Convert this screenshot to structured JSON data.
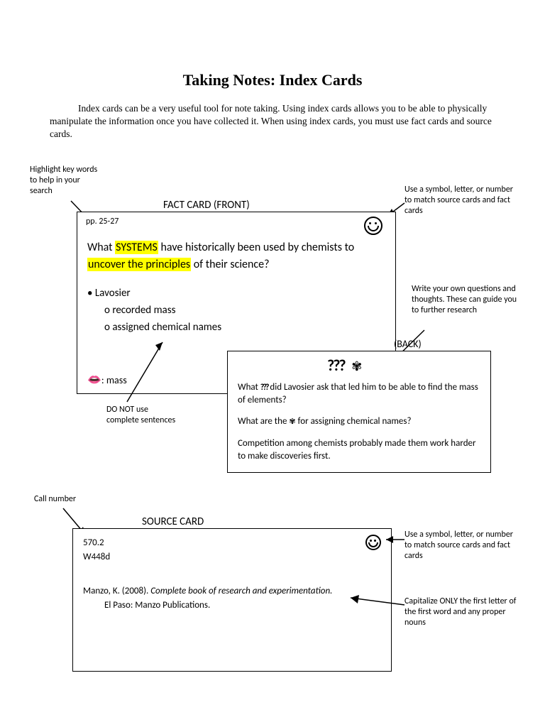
{
  "title": "Taking Notes: Index Cards",
  "intro": "Index cards can be a very useful tool for note taking.  Using index cards allows you to be able to physically manipulate the information once you have collected it.  When using index cards, you must use fact cards and source cards.",
  "callouts": {
    "highlight": "Highlight key words to help in your search",
    "match1": "Use a symbol, letter, or number to match source cards and fact cards",
    "thoughts": "Write your own questions and thoughts.  These can guide you to further research",
    "sentences": "DO NOT use complete sentences",
    "callnumber": "Call number",
    "match2": "Use a symbol, letter, or number to match source cards and fact cards",
    "capitalize": "Capitalize ONLY the first letter of the first word and any proper nouns"
  },
  "fact_card": {
    "heading": "FACT CARD (FRONT)",
    "pages": "pp. 25-27",
    "q_prefix": "What ",
    "q_hi1": "SYSTEMS",
    "q_mid": " have historically been used by chemists to ",
    "q_hi2": "uncover the principles",
    "q_suffix": " of their science?",
    "bullet": "Lavosier",
    "sub1": "recorded mass",
    "sub2": "assigned chemical names",
    "mass": ": mass"
  },
  "back_card": {
    "heading": "(BACK)",
    "line1a": "What ",
    "line1b": " did Lavosier ask that led him to be able to find the mass of elements?",
    "line2a": "What are the ",
    "line2b": " for assigning chemical names?",
    "line3": "Competition among chemists probably made them work harder to make discoveries first."
  },
  "source_card": {
    "heading": "SOURCE CARD",
    "call1": "570.2",
    "call2": "W448d",
    "cite1": "Manzo, K. (2008).  ",
    "cite_italic": "Complete book of research and experimentation.",
    "cite2": "El Paso: Manzo Publications."
  }
}
